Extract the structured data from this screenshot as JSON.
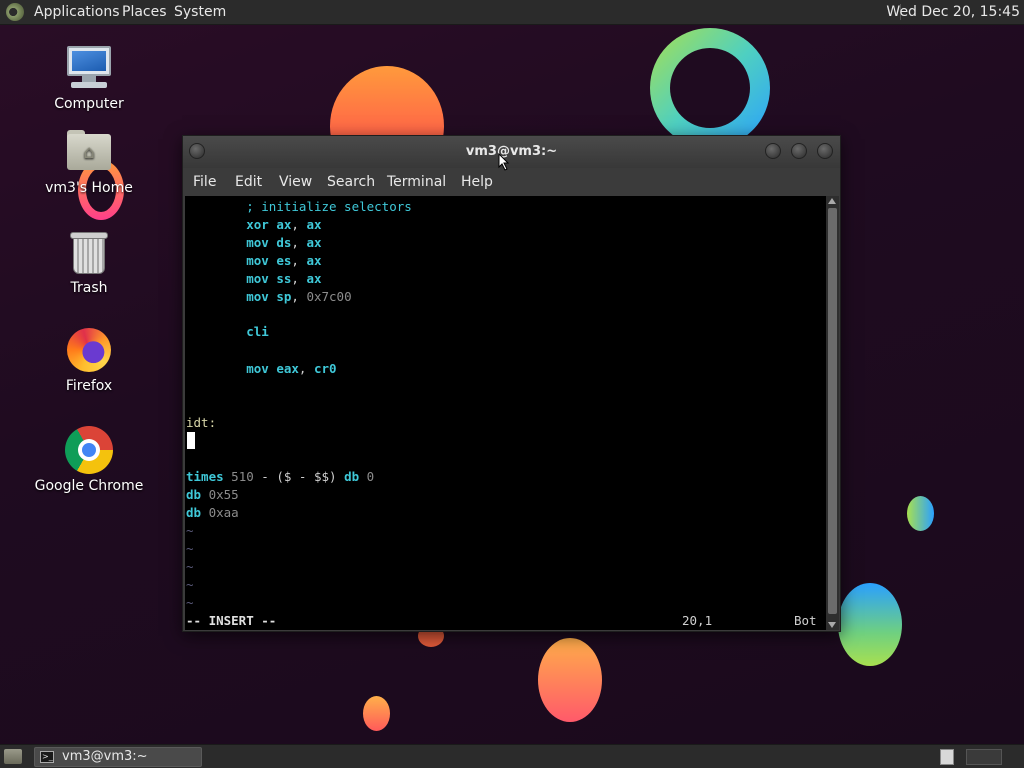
{
  "top_panel": {
    "applications": "Applications",
    "places": "Places",
    "system": "System",
    "clock": "Wed Dec 20, 15:45"
  },
  "desktop": {
    "icons": [
      {
        "label": "Computer",
        "icon": "computer-icon"
      },
      {
        "label": "vm3's Home",
        "icon": "home-folder-icon"
      },
      {
        "label": "Trash",
        "icon": "trash-icon"
      },
      {
        "label": "Firefox",
        "icon": "firefox-icon"
      },
      {
        "label": "Google Chrome",
        "icon": "chrome-icon"
      }
    ]
  },
  "terminal": {
    "title": "vm3@vm3:~",
    "menu": [
      "File",
      "Edit",
      "View",
      "Search",
      "Terminal",
      "Help"
    ],
    "lines": [
      {
        "indent": "        ",
        "comment": "; initialize selectors"
      },
      {
        "indent": "        ",
        "kw": "xor",
        "rest": " ",
        "reg1": "ax",
        "sep": ", ",
        "reg2": "ax"
      },
      {
        "indent": "        ",
        "kw": "mov",
        "rest": " ",
        "reg1": "ds",
        "sep": ", ",
        "reg2": "ax"
      },
      {
        "indent": "        ",
        "kw": "mov",
        "rest": " ",
        "reg1": "es",
        "sep": ", ",
        "reg2": "ax"
      },
      {
        "indent": "        ",
        "kw": "mov",
        "rest": " ",
        "reg1": "ss",
        "sep": ", ",
        "reg2": "ax"
      },
      {
        "indent": "        ",
        "kw": "mov",
        "rest": " ",
        "reg1": "sp",
        "sep": ", ",
        "num": "0x7c00"
      },
      {
        "indent": "        ",
        "kw": "cli"
      },
      {
        "indent": "        ",
        "kw": "mov",
        "rest": " ",
        "reg1": "eax",
        "sep": ", ",
        "reg2": "cr0"
      },
      {
        "label": "idt:"
      },
      {
        "times_kw": "times",
        "num1": "510",
        "expr": " - ($ - $$) ",
        "db_kw": "db",
        "num2": "0"
      },
      {
        "db_kw": "db",
        "num": "0x55"
      },
      {
        "db_kw": "db",
        "num": "0xaa"
      }
    ],
    "tilde": "~",
    "status": {
      "mode": "-- INSERT --",
      "position": "20,1",
      "scroll": "Bot"
    }
  },
  "taskbar": {
    "task_label": "vm3@vm3:~"
  },
  "colors": {
    "keyword": "#3fc8d8",
    "number": "#8c8c8c",
    "label": "#d8d6a8",
    "background": "#000000"
  }
}
